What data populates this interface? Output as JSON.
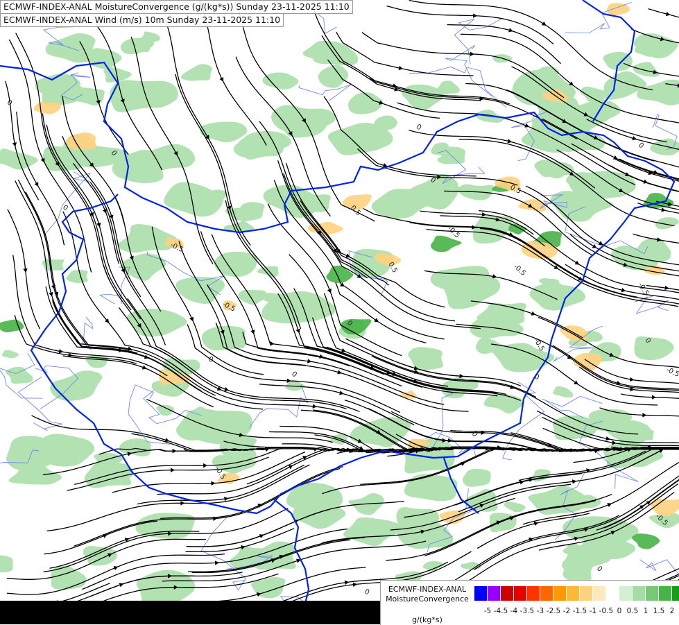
{
  "header": {
    "line1": "ECMWF-INDEX-ANAL MoistureConvergence (g/(kg*s)) Sunday 23-11-2025 11:10",
    "line2": "ECMWF-INDEX-ANAL Wind (m/s) 10m Sunday 23-11-2025 11:10"
  },
  "legend": {
    "title_line1": "ECMWF-INDEX-ANAL",
    "title_line2": "MoistureConvergence",
    "units": "g/(kg*s)",
    "colors": [
      "#0000ff",
      "#9900ff",
      "#cc0000",
      "#e60000",
      "#ff3300",
      "#ff6600",
      "#ff9900",
      "#ffb833",
      "#ffd27f",
      "#ffe8bf",
      "#ffffff",
      "#d2f0d2",
      "#a5dca5",
      "#78c878",
      "#46b446",
      "#14a014"
    ],
    "ticks": [
      "-5",
      "-4.5",
      "-4",
      "-3.5",
      "-3",
      "-2.5",
      "-2",
      "-1.5",
      "-1",
      "-0.5",
      "0",
      "0.5",
      "1",
      "1.5",
      "2"
    ]
  },
  "map": {
    "contour_labels": [
      "0",
      "0",
      "0",
      "0",
      "0",
      "0",
      "0",
      "0",
      "0",
      "0",
      "0",
      "0",
      "0",
      "-0.5",
      "-0.5",
      "-0.5",
      "-0.5",
      "-0.5",
      "-0.5",
      "-0.5",
      "-0.5",
      "0.5",
      "0.5",
      "0.5",
      "-0.5",
      "0"
    ],
    "colors": {
      "green_fill": "#a5dca5",
      "dark_green": "#46b446",
      "orange_fill": "#ffd27f",
      "border": "#0022ee",
      "river": "#6f8ae6",
      "streamline": "#000000"
    }
  }
}
